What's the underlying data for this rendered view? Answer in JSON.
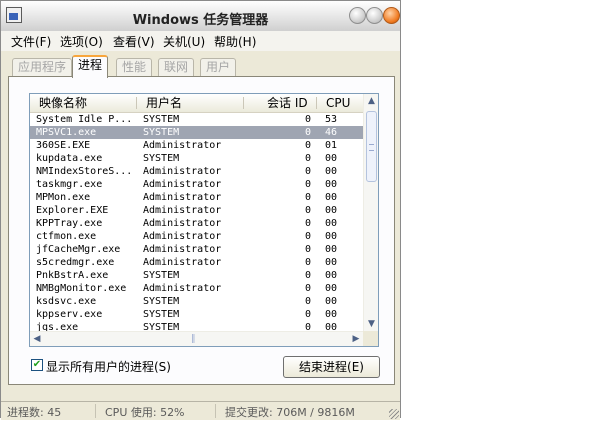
{
  "window": {
    "title": "Windows 任务管理器"
  },
  "menu": [
    {
      "label": "文件(F)"
    },
    {
      "label": "选项(O)"
    },
    {
      "label": "查看(V)"
    },
    {
      "label": "关机(U)"
    },
    {
      "label": "帮助(H)"
    }
  ],
  "tabs": [
    {
      "label": "应用程序",
      "active": false
    },
    {
      "label": "进程",
      "active": true
    },
    {
      "label": "性能",
      "active": false
    },
    {
      "label": "联网",
      "active": false
    },
    {
      "label": "用户",
      "active": false
    }
  ],
  "process_table": {
    "columns": [
      "映像名称",
      "用户名",
      "会话 ID",
      "CPU"
    ],
    "selected_row": 1,
    "rows": [
      {
        "name": "System Idle P...",
        "user": "SYSTEM",
        "session": "0",
        "cpu": "53"
      },
      {
        "name": "MPSVC1.exe",
        "user": "SYSTEM",
        "session": "0",
        "cpu": "46"
      },
      {
        "name": "360SE.EXE",
        "user": "Administrator",
        "session": "0",
        "cpu": "01"
      },
      {
        "name": "kupdata.exe",
        "user": "SYSTEM",
        "session": "0",
        "cpu": "00"
      },
      {
        "name": "NMIndexStoreS...",
        "user": "Administrator",
        "session": "0",
        "cpu": "00"
      },
      {
        "name": "taskmgr.exe",
        "user": "Administrator",
        "session": "0",
        "cpu": "00"
      },
      {
        "name": "MPMon.exe",
        "user": "Administrator",
        "session": "0",
        "cpu": "00"
      },
      {
        "name": "Explorer.EXE",
        "user": "Administrator",
        "session": "0",
        "cpu": "00"
      },
      {
        "name": "KPPTray.exe",
        "user": "Administrator",
        "session": "0",
        "cpu": "00"
      },
      {
        "name": "ctfmon.exe",
        "user": "Administrator",
        "session": "0",
        "cpu": "00"
      },
      {
        "name": "jfCacheMgr.exe",
        "user": "Administrator",
        "session": "0",
        "cpu": "00"
      },
      {
        "name": "s5credmgr.exe",
        "user": "Administrator",
        "session": "0",
        "cpu": "00"
      },
      {
        "name": "PnkBstrA.exe",
        "user": "SYSTEM",
        "session": "0",
        "cpu": "00"
      },
      {
        "name": "NMBgMonitor.exe",
        "user": "Administrator",
        "session": "0",
        "cpu": "00"
      },
      {
        "name": "ksdsvc.exe",
        "user": "SYSTEM",
        "session": "0",
        "cpu": "00"
      },
      {
        "name": "kppserv.exe",
        "user": "SYSTEM",
        "session": "0",
        "cpu": "00"
      },
      {
        "name": "jqs.exe",
        "user": "SYSTEM",
        "session": "0",
        "cpu": "00"
      }
    ]
  },
  "show_all_users": {
    "label": "显示所有用户的进程(S)",
    "checked": true
  },
  "end_process_button": {
    "label": "结束进程(E)"
  },
  "status": {
    "processes": "进程数: 45",
    "cpu": "CPU 使用: 52%",
    "commit": "提交更改: 706M / 9816M"
  },
  "icons": {
    "app": "task-manager-icon",
    "minimize": "minimize-icon",
    "maximize": "maximize-icon",
    "close": "close-icon",
    "scroll_up": "arrow-up-icon",
    "scroll_down": "arrow-down-icon",
    "scroll_left": "arrow-left-icon",
    "scroll_right": "arrow-right-icon",
    "check": "checkmark-icon"
  },
  "colors": {
    "active_tab_accent": "#f8a63c",
    "selected_row": "#9fa5b2",
    "close_button": "#f07a20",
    "checkmark": "#21a121"
  }
}
